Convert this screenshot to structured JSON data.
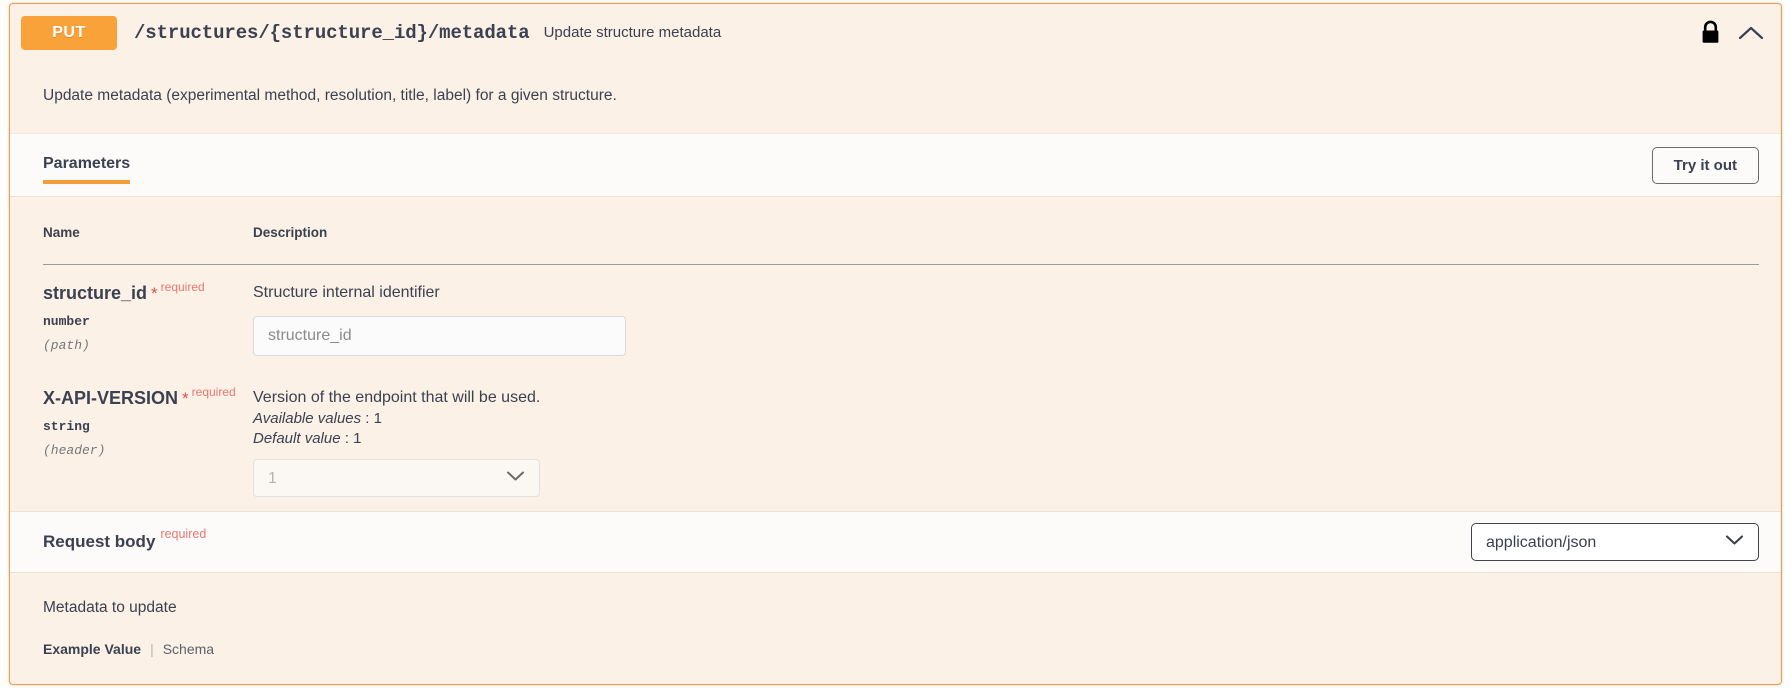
{
  "operation": {
    "method": "PUT",
    "path": "/structures/{structure_id}/metadata",
    "summary": "Update structure metadata",
    "description": "Update metadata (experimental method, resolution, title, label) for a given structure.",
    "lock_icon": "lock-icon",
    "collapse_icon": "chevron-up-icon"
  },
  "tabs": {
    "parameters_label": "Parameters",
    "try_it_out_label": "Try it out"
  },
  "parameters_table": {
    "headers": {
      "name": "Name",
      "description": "Description"
    },
    "rows": [
      {
        "name": "structure_id",
        "required_star": "*",
        "required_label": "required",
        "type": "number",
        "location": "(path)",
        "description": "Structure internal identifier",
        "control": "input",
        "placeholder": "structure_id",
        "value": ""
      },
      {
        "name": "X-API-VERSION",
        "required_star": "*",
        "required_label": "required",
        "type": "string",
        "location": "(header)",
        "description": "Version of the endpoint that will be used.",
        "available_values_label": "Available values",
        "available_values": "1",
        "default_value_label": "Default value",
        "default_value": "1",
        "control": "select",
        "selected": "1",
        "options": [
          "1"
        ]
      }
    ]
  },
  "request_body": {
    "label": "Request body",
    "required_label": "required",
    "content_type_selected": "application/json",
    "content_type_options": [
      "application/json"
    ],
    "note": "Metadata to update",
    "example_tab": "Example Value",
    "tab_divider": "|",
    "schema_tab": "Schema"
  },
  "colors": {
    "method_badge": "#f9a23a",
    "block_border": "#f59c3c",
    "block_background": "#fbf1e6",
    "panel_background": "#fcfbfa",
    "text": "#3b4151",
    "required": "#ea7873",
    "accent_underline": "#f59c3c"
  }
}
